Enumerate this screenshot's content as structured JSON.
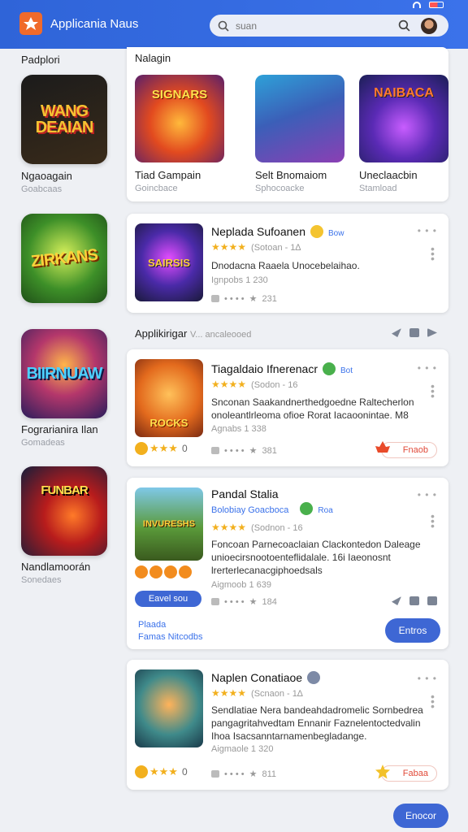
{
  "header": {
    "app_title": "Applicania Naus",
    "search_placeholder": "suan"
  },
  "sidebar": {
    "heading": "Padplori",
    "games": [
      {
        "art": "WANG DEAIAN",
        "name": "Ngaoagain",
        "sub": "Goabcaas"
      },
      {
        "art": "ZIRKANS",
        "name": "",
        "sub": ""
      },
      {
        "art": "BIIRNUAW",
        "name": "Fograrianira Ilan",
        "sub": "Gomadeas"
      },
      {
        "art": "FUNBAR",
        "name": "Nandlamoorán",
        "sub": "Sonedaes"
      }
    ]
  },
  "featured": {
    "heading": "Nalagin",
    "items": [
      {
        "art": "SIGNARS",
        "name": "Tiad Gampain",
        "sub": "Goincbace"
      },
      {
        "art": "",
        "name": "Selt Bnomaiom",
        "sub": "Sphocoacke"
      },
      {
        "art": "NAIBACA",
        "name": "Uneclaacbin",
        "sub": "Stamload"
      }
    ]
  },
  "section": {
    "title": "Applikirigar",
    "subtitle": "V... ancaleooed"
  },
  "cards": [
    {
      "art": "SAIRSIS",
      "title": "Neplada Sufoanen",
      "tag": "Bow",
      "stars": "★★★★",
      "count": "(Sotoan - 1∆",
      "desc": "Dnodacna Raaela Unocebelaihao.",
      "meta": "Ignpobs 1 230",
      "likes": "231"
    },
    {
      "art": "ROCKS",
      "title": "Tiagaldaio Ifnerenacr",
      "tag": "Bot",
      "stars": "★★★★",
      "count": "(Sodon - 16",
      "desc": "Snconan Saakandnerthedgoedne Raltecherlon onoleantlrleoma ofioe Rorat Iacaoonintae. M8",
      "meta": "Agnabs 1 338",
      "rating": "0",
      "likes": "381",
      "pill": "Fnaob"
    },
    {
      "art": "INVURESHS",
      "title": "Pandal Stalia",
      "subtitle": "Bolobiay Goacboca",
      "tag": "Roa",
      "stars": "★★★★",
      "count": "(Sodnon - 16",
      "desc": "Foncoan Parnecoaclaian Clackontedon Daleage unioecirsnootoenteflidalale. 16i Iaeonosnt lrerterlecanacgiphoedsals",
      "meta": "Aigmoob 1 639",
      "likes": "184",
      "chip": "Eavel sou",
      "link1": "Plaada",
      "link2": "Famas Nitcodbs",
      "button": "Entros"
    },
    {
      "art": "",
      "title": "Naplen Conatiaoe",
      "tag": "",
      "stars": "★★★★",
      "count": "(Scnaon - 1∆",
      "desc": "Sendlatiae Nera bandeahdadromelic Sornbedrea pangagritahvedtam Ennanir Faznelentoctedvalin Ihoa Isacsanntarnamenbegladange.",
      "meta": "Aigmaole 1 320",
      "rating": "0",
      "likes": "811",
      "pill": "Fabaa"
    }
  ],
  "footer_button": "Enocor",
  "colors": {
    "accent": "#3e67d4",
    "header": "#3366dd",
    "star": "#f2b01e"
  }
}
